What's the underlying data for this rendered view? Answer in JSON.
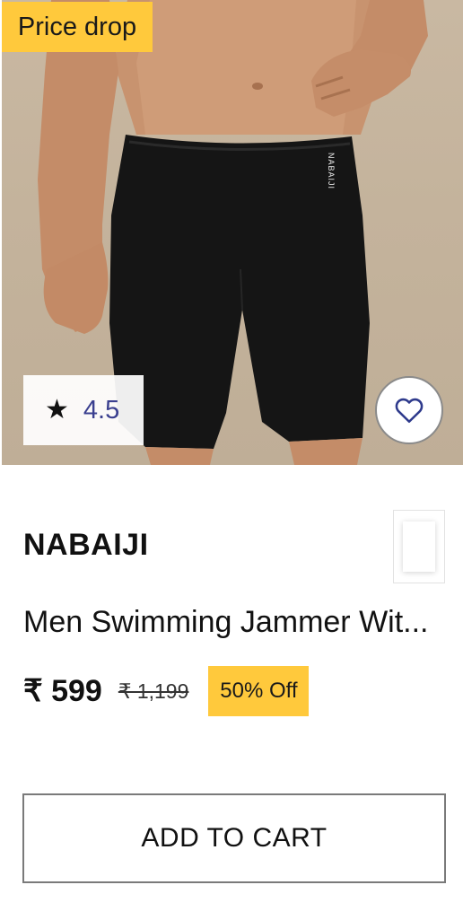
{
  "product": {
    "badge": "Price drop",
    "rating": {
      "star": "★",
      "value": "4.5"
    },
    "wishlist_icon": "heart-outline-icon",
    "brand": "NABAIJI",
    "waistband_logo": "NABAIJI",
    "name": "Men Swimming Jammer Wit...",
    "price": {
      "current": "₹ 599",
      "original": "₹ 1,199",
      "discount": "50% Off"
    },
    "add_to_cart_label": "ADD TO CART"
  },
  "colors": {
    "accent_yellow": "#ffc93c",
    "rating_text": "#3a3f8f",
    "background": "#ffffff",
    "product_image_bg": "#c6b59e"
  }
}
